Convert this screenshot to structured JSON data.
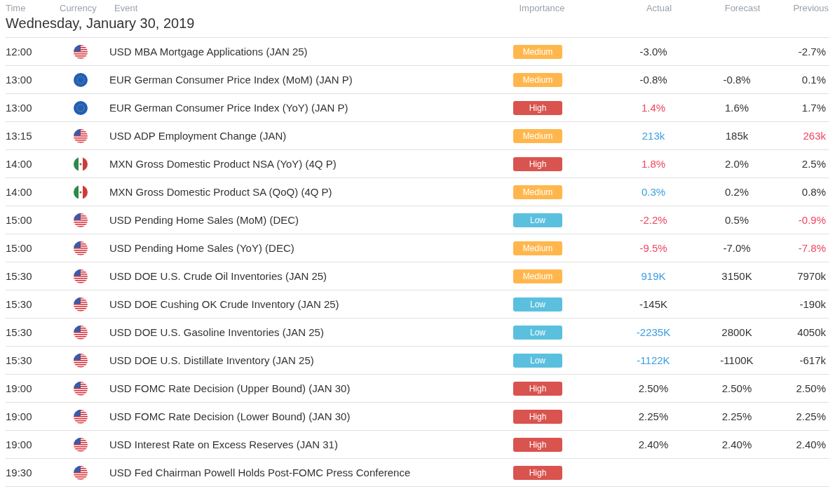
{
  "columns": [
    "Time",
    "Currency",
    "Event",
    "Importance",
    "Actual",
    "Forecast",
    "Previous"
  ],
  "date": "Wednesday, January 30, 2019",
  "rows": [
    {
      "time": "12:00",
      "flag": {
        "kind": "us"
      },
      "event": "USD MBA Mortgage Applications (JAN 25)",
      "importance": {
        "kind": "medium",
        "label": "Medium"
      },
      "actual": {
        "text": "-3.0%",
        "color": "#333333"
      },
      "previous": {
        "text": "-2.7%",
        "color": "#333333"
      }
    },
    {
      "time": "13:00",
      "flag": {
        "kind": "eu"
      },
      "event": "EUR German Consumer Price Index (MoM) (JAN P)",
      "importance": {
        "kind": "medium",
        "label": "Medium"
      },
      "actual": {
        "text": "-0.8%",
        "color": "#333333"
      },
      "forecast": "-0.8%",
      "previous": {
        "text": "0.1%",
        "color": "#333333"
      }
    },
    {
      "time": "13:00",
      "flag": {
        "kind": "eu"
      },
      "event": "EUR German Consumer Price Index (YoY) (JAN P)",
      "importance": {
        "kind": "high",
        "label": "High"
      },
      "actual": {
        "text": "1.4%",
        "color": "#f0445e"
      },
      "forecast": "1.6%",
      "previous": {
        "text": "1.7%",
        "color": "#333333"
      }
    },
    {
      "time": "13:15",
      "flag": {
        "kind": "us"
      },
      "event": "USD ADP Employment Change (JAN)",
      "importance": {
        "kind": "medium",
        "label": "Medium"
      },
      "actual": {
        "text": "213k",
        "color": "#3a9ee0"
      },
      "forecast": "185k",
      "previous": {
        "text": "263k",
        "color": "#f0445e"
      }
    },
    {
      "time": "14:00",
      "flag": {
        "kind": "mx"
      },
      "event": "MXN Gross Domestic Product NSA (YoY) (4Q P)",
      "importance": {
        "kind": "high",
        "label": "High"
      },
      "actual": {
        "text": "1.8%",
        "color": "#f0445e"
      },
      "forecast": "2.0%",
      "previous": {
        "text": "2.5%",
        "color": "#333333"
      }
    },
    {
      "time": "14:00",
      "flag": {
        "kind": "mx"
      },
      "event": "MXN Gross Domestic Product SA (QoQ) (4Q P)",
      "importance": {
        "kind": "medium",
        "label": "Medium"
      },
      "actual": {
        "text": "0.3%",
        "color": "#3a9ee0"
      },
      "forecast": "0.2%",
      "previous": {
        "text": "0.8%",
        "color": "#333333"
      }
    },
    {
      "time": "15:00",
      "flag": {
        "kind": "us"
      },
      "event": "USD Pending Home Sales (MoM) (DEC)",
      "importance": {
        "kind": "low",
        "label": "Low"
      },
      "actual": {
        "text": "-2.2%",
        "color": "#f0445e"
      },
      "forecast": "0.5%",
      "previous": {
        "text": "-0.9%",
        "color": "#f0445e"
      }
    },
    {
      "time": "15:00",
      "flag": {
        "kind": "us"
      },
      "event": "USD Pending Home Sales (YoY) (DEC)",
      "importance": {
        "kind": "medium",
        "label": "Medium"
      },
      "actual": {
        "text": "-9.5%",
        "color": "#f0445e"
      },
      "forecast": "-7.0%",
      "previous": {
        "text": "-7.8%",
        "color": "#f0445e"
      }
    },
    {
      "time": "15:30",
      "flag": {
        "kind": "us"
      },
      "event": "USD DOE U.S. Crude Oil Inventories (JAN 25)",
      "importance": {
        "kind": "medium",
        "label": "Medium"
      },
      "actual": {
        "text": "919K",
        "color": "#3a9ee0"
      },
      "forecast": "3150K",
      "previous": {
        "text": "7970k",
        "color": "#333333"
      }
    },
    {
      "time": "15:30",
      "flag": {
        "kind": "us"
      },
      "event": "USD DOE Cushing OK Crude Inventory (JAN 25)",
      "importance": {
        "kind": "low",
        "label": "Low"
      },
      "actual": {
        "text": "-145K",
        "color": "#333333"
      },
      "previous": {
        "text": "-190k",
        "color": "#333333"
      }
    },
    {
      "time": "15:30",
      "flag": {
        "kind": "us"
      },
      "event": "USD DOE U.S. Gasoline Inventories (JAN 25)",
      "importance": {
        "kind": "low",
        "label": "Low"
      },
      "actual": {
        "text": "-2235K",
        "color": "#3a9ee0"
      },
      "forecast": "2800K",
      "previous": {
        "text": "4050k",
        "color": "#333333"
      }
    },
    {
      "time": "15:30",
      "flag": {
        "kind": "us"
      },
      "event": "USD DOE U.S. Distillate Inventory (JAN 25)",
      "importance": {
        "kind": "low",
        "label": "Low"
      },
      "actual": {
        "text": "-1122K",
        "color": "#3a9ee0"
      },
      "forecast": "-1100K",
      "previous": {
        "text": "-617k",
        "color": "#333333"
      }
    },
    {
      "time": "19:00",
      "flag": {
        "kind": "us"
      },
      "event": "USD FOMC Rate Decision (Upper Bound) (JAN 30)",
      "importance": {
        "kind": "high",
        "label": "High"
      },
      "actual": {
        "text": "2.50%",
        "color": "#333333"
      },
      "forecast": "2.50%",
      "previous": {
        "text": "2.50%",
        "color": "#333333"
      }
    },
    {
      "time": "19:00",
      "flag": {
        "kind": "us"
      },
      "event": "USD FOMC Rate Decision (Lower Bound) (JAN 30)",
      "importance": {
        "kind": "high",
        "label": "High"
      },
      "actual": {
        "text": "2.25%",
        "color": "#333333"
      },
      "forecast": "2.25%",
      "previous": {
        "text": "2.25%",
        "color": "#333333"
      }
    },
    {
      "time": "19:00",
      "flag": {
        "kind": "us"
      },
      "event": "USD Interest Rate on Excess Reserves (JAN 31)",
      "importance": {
        "kind": "high",
        "label": "High"
      },
      "actual": {
        "text": "2.40%",
        "color": "#333333"
      },
      "forecast": "2.40%",
      "previous": {
        "text": "2.40%",
        "color": "#333333"
      }
    },
    {
      "time": "19:30",
      "flag": {
        "kind": "us"
      },
      "event": "USD Fed Chairman Powell Holds Post-FOMC Press Conference",
      "importance": {
        "kind": "high",
        "label": "High"
      }
    }
  ]
}
